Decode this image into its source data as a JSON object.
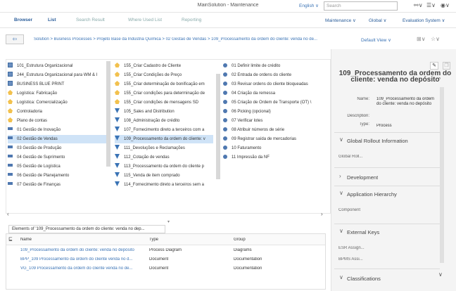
{
  "app_title": "MainSolution - Maintenance",
  "language": "English ∨",
  "search_placeholder": "Search",
  "nav": {
    "items": [
      "Browser",
      "List",
      "Search Result",
      "Where Used List",
      "Reporting"
    ],
    "right": [
      "Maintenance ∨",
      "Global ∨",
      "Evaluation System ∨"
    ]
  },
  "breadcrumb": "Solution > Business Processes > Projeto Base da Indústria Química > 02 Gestão de Vendas > 109_Processamento da ordem do cliente: venda no de...",
  "default_view": "Default View ∨",
  "col1": [
    {
      "icon": "sq",
      "label": "101_Estrutura Organizacional"
    },
    {
      "icon": "sq",
      "label": "244_Estrutura Organizacional para WM & I"
    },
    {
      "icon": "sq",
      "label": "BUSINESS BLUE PRINT"
    },
    {
      "icon": "hat",
      "label": "Logística: Fabricação"
    },
    {
      "icon": "hat",
      "label": "Logística: Comercialização"
    },
    {
      "icon": "hat",
      "label": "Controladoria"
    },
    {
      "icon": "hat",
      "label": "Plano de contas"
    },
    {
      "icon": "bar",
      "label": "01 Gestão de Inovação"
    },
    {
      "icon": "bar",
      "label": "02 Gestão de Vendas"
    },
    {
      "icon": "bar",
      "label": "03 Gestão de Produção"
    },
    {
      "icon": "bar",
      "label": "04 Gestão de Suprimento"
    },
    {
      "icon": "bar",
      "label": "05 Gestão de Logística"
    },
    {
      "icon": "bar",
      "label": "06 Gestão de Planejamento"
    },
    {
      "icon": "bar",
      "label": "07 Gestão de Finanças"
    }
  ],
  "col2": [
    {
      "icon": "hat",
      "label": "155_Criar Cadastro de Cliente"
    },
    {
      "icon": "hat",
      "label": "155_Criar Condições de Preço"
    },
    {
      "icon": "hat",
      "label": "155_Criar determinação de bonificação em"
    },
    {
      "icon": "hat",
      "label": "155_Criar condições para determinação de"
    },
    {
      "icon": "hat",
      "label": "155_Criar condições de mensagens SD"
    },
    {
      "icon": "tri",
      "label": "105_Sales and Distribution"
    },
    {
      "icon": "tri",
      "label": "108_Administração de crédito"
    },
    {
      "icon": "tri",
      "label": "107_Fornecimento direto a terceiros com a"
    },
    {
      "icon": "tri",
      "label": "109_Processamento da ordem do cliente: v"
    },
    {
      "icon": "tri",
      "label": "111_Devoluções e Reclamações"
    },
    {
      "icon": "tri",
      "label": "112_Cotação de vendas"
    },
    {
      "icon": "tri",
      "label": "113_Processamento da ordem do cliente p"
    },
    {
      "icon": "tri",
      "label": "115_Venda de item comprado"
    },
    {
      "icon": "tri",
      "label": "114_Fornecimento direto a terceiros sem a"
    }
  ],
  "col3": [
    "01 Definir limite de crédito",
    "02 Entrada de ordens do cliente",
    "03 Revisar ordens do cliente bloqueadas",
    "04 Criação da remessa",
    "05 Criação de Ordem de Transporte (OT) \\",
    "06 Picking (opcional)",
    "07 Verificar lotes",
    "08 Atribuir números de série",
    "09 Registrar saída de mercadorias",
    "10 Faturamento",
    "11 Impressão da NF"
  ],
  "elements_tab": "Elements of '109_Processamento da ordem do cliente: venda no dep...",
  "table": {
    "headers": [
      "Name",
      "Type",
      "Group"
    ],
    "rows": [
      [
        "109_Processamento da ordem do cliente: venda no depósito",
        "Process Diagram",
        "Diagrams"
      ],
      [
        "BPP_109 Processamento da ordem do cliente venda no d...",
        "Document",
        "Documentation"
      ],
      [
        "VG_109 Processamento da ordem do cliente venda no de...",
        "Document",
        "Documentation"
      ]
    ]
  },
  "detail": {
    "title": "109_Processamento da ordem do cliente: venda no depósito",
    "name_label": "Name:",
    "name_value": "109_Processamento da ordem do cliente: venda no depósito",
    "desc_label": "Description:",
    "type_label": "Type:",
    "type_value": "Process",
    "sections": {
      "global_rollout": "Global Rollout Information",
      "global_roll_sub": "Global Roll...",
      "development": "Development",
      "app_hierarchy": "Application Hierarchy",
      "component": "Component",
      "external_keys": "External Keys",
      "esr": "ESR Assign...",
      "bpms": "BPMS Assi...",
      "classifications": "Classifications"
    }
  },
  "colors": {
    "accent": "#3a73b5",
    "highlight": "#cfe3f7"
  }
}
